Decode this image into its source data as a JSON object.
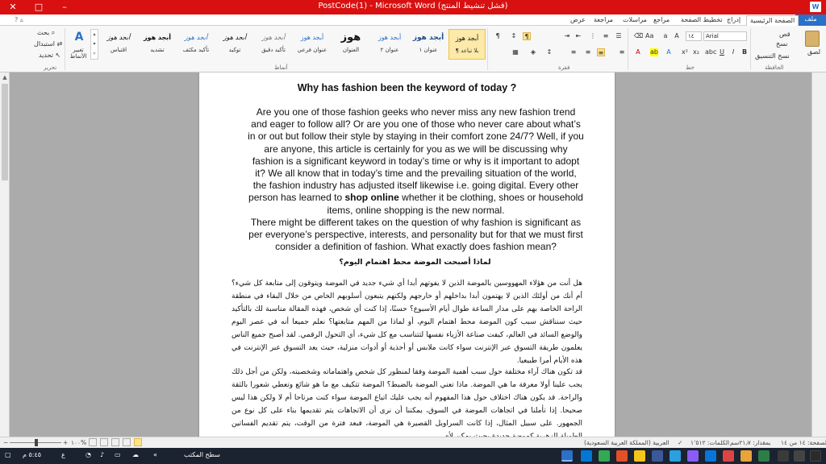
{
  "window": {
    "title": "PostCode(1) - Microsoft Word (فشل تنشيط المنتج)",
    "controls": [
      "✕",
      "□",
      "–"
    ]
  },
  "tabs": [
    "ملف",
    "الصفحة الرئيسية",
    "إدراج",
    "تخطيط الصفحة",
    "مراجع",
    "مراسلات",
    "مراجعة",
    "عرض"
  ],
  "ribbon": {
    "clipboard": {
      "paste": "لصق",
      "cut": "قص",
      "copy": "نسخ",
      "format_painter": "نسخ التنسيق",
      "group": "الحافظة"
    },
    "font": {
      "name": "Arial",
      "size": "١٤",
      "group": "خط"
    },
    "paragraph": {
      "group": "فقرة"
    },
    "styles": {
      "group": "أنماط",
      "items": [
        {
          "sample": "أبجد هوز",
          "name": "¶ بلا تباعد"
        },
        {
          "sample": "أبجد هوز",
          "name": "عنوان ١"
        },
        {
          "sample": "أبجد هوز",
          "name": "عنوان ٢"
        },
        {
          "sample": "هوز",
          "name": "العنوان"
        },
        {
          "sample": "أبجد هوز",
          "name": "عنوان فرعي"
        },
        {
          "sample": "أبجد هوز",
          "name": "تأكيد دقيق"
        },
        {
          "sample": "أبجد هوز",
          "name": "توكيد"
        },
        {
          "sample": "أبجد هوز",
          "name": "تأكيد مكثف"
        },
        {
          "sample": "أبجد هوز",
          "name": "تشديد"
        },
        {
          "sample": "أبجد هوز",
          "name": "اقتباس"
        }
      ],
      "change": "تغيير الأنماط"
    },
    "editing": {
      "find": "بحث",
      "replace": "استبدال",
      "select": "تحديد",
      "group": "تحرير"
    }
  },
  "document": {
    "title": "Why has fashion been the keyword of today ?",
    "en_before": "Are you one of those fashion geeks who never miss any new fashion trend and eager to follow all? Or are you one of those who never care about what’s in or out but follow their style by staying in their comfort zone 24/7? Well, if you are anyone, this article is certainly for you as we will be discussing why fashion is a significant keyword in today’s time or why is it important to adopt it? We all know that in today’s time and the prevailing situation of the world, the fashion industry has adjusted itself likewise i.e. going digital. Every other person has learned to",
    "en_bold": "shop online",
    "en_after": "whether it be clothing, shoes or household items, online shopping is the new normal.",
    "en_para2": "There might be different takes on the question of why fashion is significant as per everyone’s perspective, interests, and personality but for that we must first consider a definition of fashion. What exactly does fashion mean?",
    "ar_title": "لماذا أصبحت الموضة محط اهتمام اليوم؟",
    "ar_para1": "هل أنت من هؤلاء المهووسين بالموضة الذين لا يفوتهم أبدا أي شيء جديد في الموضة ويتوقون إلى متابعة كل شيء؟ أم أنك من أولئك الذين لا يهتمون أبدا بداخلهم أو خارجهم ولكنهم يتبعون أسلوبهم الخاص من خلال البقاء في منطقة الراحة الخاصة بهم على مدار الساعة طوال أيام الأسبوع؟ حسنًا، إذا كنت أي شخص، فهذه المقالة مناسبة لك بالتأكيد حيث سنناقش سبب كون الموضة محط اهتمام اليوم، أو لماذا من المهم متابعتها؟ نعلم جميعا أنه في عصر اليوم والوضع السائد في العالم، كيفت صناعة الأزياء نفسها لتتناسب مع كل شيء، أي التحول الرقمي. لقد أصبح جميع الناس يعلمون طريقة التسوق عبر الإنترنت سواء كانت ملابس أو أحذية أو أدوات منزلية، حيث يعد التسوق عبر الإنترنت في هذه الأيام أمرا طبيعيا.",
    "ar_para2": "قد تكون هناك آراء مختلفة حول سبب أهمية الموضة وفقا لمنظور كل شخص واهتماماته وشخصيته، ولكن من أجل ذلك يجب علينا أولا معرفة ما هي الموضة. ماذا تعني الموضة بالضبط؟ الموضة تتكيف مع ما هو شائع وتعطي شعورا بالثقة والراحة. قد يكون هناك اختلاف حول هذا المفهوم أنه يجب عليك اتباع الموضة سواء كنت مرتاحا أم لا ولكن هذا ليس صحيحا. إذا تأملنا في اتجاهات الموضة في السوق، يمكننا أن نرى أن الاتجاهات يتم تقديمها بناء على كل نوع من الجمهور. على سبيل المثال، إذا كانت السراويل القصيرة هي الموضة، فبعد فترة من الوقت، يتم تقديم الفساتين الطويلة الزهرية كموضة جديدة بحيث يمكن لأي"
  },
  "status": {
    "page": "الصفحة: ١٤ من ١٤",
    "position": "بمقدار: ٢١٫٧سم",
    "words": "الكلمات: ١٬٥١٢",
    "language": "العربية (المملكة العربية السعودية)",
    "zoom": "١٠٠%"
  },
  "taskbar": {
    "desktop": "سطح المكتب",
    "time": "٥:٤٥ م",
    "lang": "ع"
  }
}
